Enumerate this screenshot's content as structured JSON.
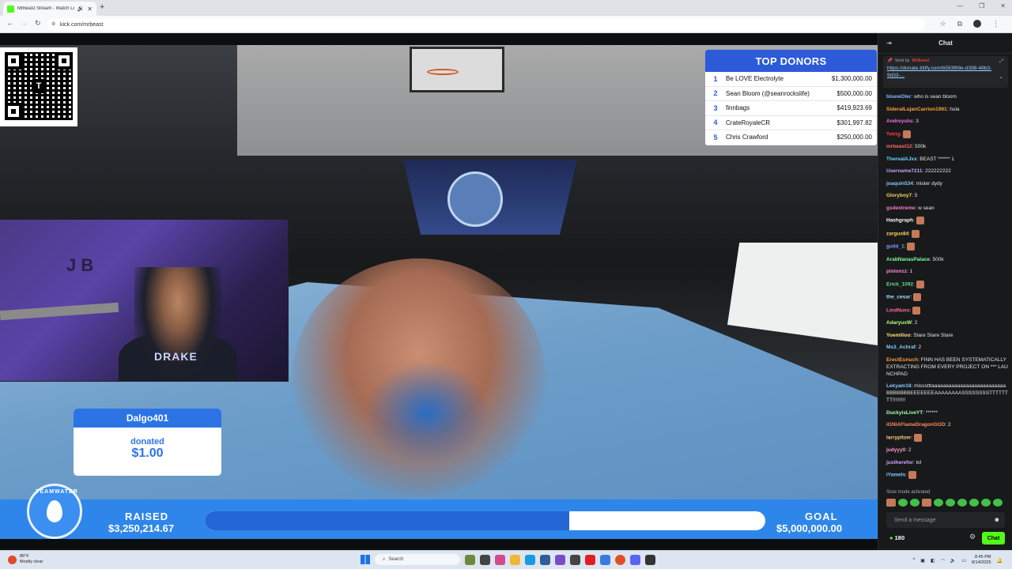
{
  "browser": {
    "tab_title": "MrBeast Stream - Watch Li...",
    "url": "kick.com/mrbeast"
  },
  "stream": {
    "donors": {
      "title": "TOP DONORS",
      "rows": [
        {
          "rank": "1",
          "name": "Be LOVE Electrolyte",
          "amount": "$1,300,000.00"
        },
        {
          "rank": "2",
          "name": "Sean Bloom (@seanrockslife)",
          "amount": "$500,000.00"
        },
        {
          "rank": "3",
          "name": "finnbags",
          "amount": "$419,923.69"
        },
        {
          "rank": "4",
          "name": "CrateRoyaleCR",
          "amount": "$301,997.82"
        },
        {
          "rank": "5",
          "name": "Chris Crawford",
          "amount": "$250,000.00"
        }
      ]
    },
    "webcam": {
      "letters": "J B",
      "shirt_text": "DRAKE"
    },
    "alert": {
      "name": "Dalgo401",
      "label": "donated",
      "amount": "$1.00"
    },
    "progress": {
      "logo_text": "TEAMWATER",
      "raised_label": "RAISED",
      "raised_value": "$3,250,214.67",
      "goal_label": "GOAL",
      "goal_value": "$5,000,000.00",
      "fraction": 0.65
    },
    "colors": {
      "band": "#2f86ea",
      "fill": "#2466d6",
      "donor_head": "#2c5ad8"
    }
  },
  "chat": {
    "title": "Chat",
    "pinned": {
      "sent_by": "Sent by",
      "author": "MrBeast",
      "link": "https://donate.tiltify.com/b593f69e-d398-48b3-9d33-..."
    },
    "messages": [
      {
        "user": "bluewOler",
        "color": "#7fb8ff",
        "text": "who is sean bloom"
      },
      {
        "user": "SideralLujanCarrion1991",
        "color": "#ff9f3a",
        "text": "hola"
      },
      {
        "user": "Andreyshs",
        "color": "#f26ff0",
        "text": "3"
      },
      {
        "user": "Tetrig",
        "color": "#ff3b3b",
        "text": ""
      },
      {
        "user": "mrbeast12",
        "color": "#ff6a6a",
        "text": "500k"
      },
      {
        "user": "ThereaIAJxx",
        "color": "#6fd3ff",
        "text": "BEAST ****** 1"
      },
      {
        "user": "Username7211",
        "color": "#c9a2ff",
        "text": "222222222"
      },
      {
        "user": "joaquin534",
        "color": "#8ac7ff",
        "text": "mister dydy"
      },
      {
        "user": "Gloryboy7",
        "color": "#f0d45a",
        "text": "5"
      },
      {
        "user": "gsdextreme",
        "color": "#ff7ac8",
        "text": "w sean"
      },
      {
        "user": "Hashgraph",
        "color": "#ffffff",
        "text": ""
      },
      {
        "user": "zargus84",
        "color": "#ffd95a",
        "text": ""
      },
      {
        "user": "guild_1",
        "color": "#7f9cff",
        "text": ""
      },
      {
        "user": "ArabNanasPalace",
        "color": "#7dff9a",
        "text": "500k"
      },
      {
        "user": "pistonzz",
        "color": "#ff8ad8",
        "text": "1"
      },
      {
        "user": "Erick_1092",
        "color": "#5ce08a",
        "text": ""
      },
      {
        "user": "the_cesar",
        "color": "#9be1ff",
        "text": ""
      },
      {
        "user": "LindNuex",
        "color": "#ff6a9a",
        "text": ""
      },
      {
        "user": "AdaryusW",
        "color": "#b2ff7a",
        "text": "2"
      },
      {
        "user": "Yoemilioo",
        "color": "#ffe07a",
        "text": "Stare Stare Stare"
      },
      {
        "user": "Ms3_Achraf",
        "color": "#7ad0ff",
        "text": "2"
      },
      {
        "user": "ErectEunuch",
        "color": "#ff9a3a",
        "text": "FINN HAS BEEN SYSTEMATICALLY EXTRACTING FROM EVERY PROJECT ON *** LAUNCHPAD"
      },
      {
        "user": "Lekyam18",
        "color": "#8ac7ff",
        "text": "missstttaaaaaaaaaaaaaaaaaaaaaaaaaaBBBBBBBEEEEEEEAAAAAAAASSSSSSSSTTTTTTTT!!!!!!!!!"
      },
      {
        "user": "DuckyisLiveYT",
        "color": "#a0ffb0",
        "text": "******"
      },
      {
        "user": "iGNIAFlameDragonGOD",
        "color": "#ff8a5a",
        "text": "2"
      },
      {
        "user": "larrypltzer",
        "color": "#ffcf7a",
        "text": ""
      },
      {
        "user": "judyyy0",
        "color": "#ff9ad0",
        "text": "2"
      },
      {
        "user": "justherefor",
        "color": "#c6a6ff",
        "text": "lol"
      },
      {
        "user": "iYamels",
        "color": "#7fd0ff",
        "text": ""
      }
    ],
    "slow_mode": "Slow mode activated",
    "input_placeholder": "Send a message",
    "viewers": "180",
    "send_label": "Chat"
  },
  "taskbar": {
    "weather_temp": "86°F",
    "weather_desc": "Mostly clear",
    "search_label": "Search",
    "time": "8:45 PM",
    "date": "8/14/2025"
  }
}
